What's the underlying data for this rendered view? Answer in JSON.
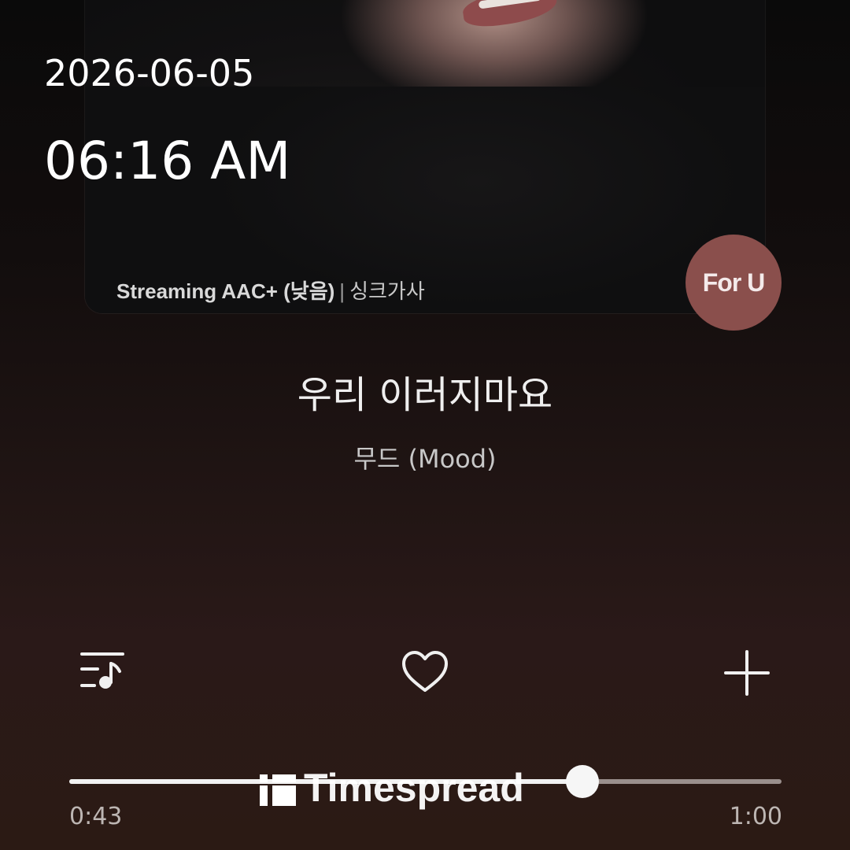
{
  "status": {
    "date": "2026-06-05",
    "time": "06:16 AM"
  },
  "album_art": {
    "quality": "Streaming AAC+ (낮음)",
    "separator": "|",
    "lyrics_mode": "싱크가사",
    "for_u_badge": "For U"
  },
  "track": {
    "title": "우리 이러지마요",
    "artist": "무드 (Mood)"
  },
  "actions": {
    "playlist_icon": "playlist-music-icon",
    "like_icon": "heart-outline-icon",
    "add_icon": "plus-icon"
  },
  "playback": {
    "elapsed": "0:43",
    "duration": "1:00",
    "progress": 0.72
  },
  "watermark": {
    "text": "Timespread"
  }
}
